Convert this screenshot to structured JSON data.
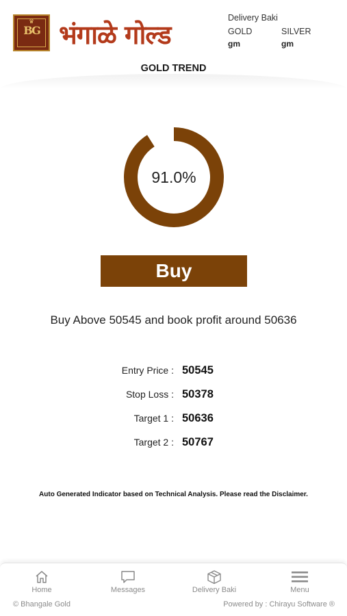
{
  "header": {
    "logo_icon": "bg-monogram-logo",
    "brand_name": "भंगाळे गोल्ड",
    "delivery_baki_title": "Delivery Baki",
    "gold_label": "GOLD",
    "gold_unit": "gm",
    "silver_label": "SILVER",
    "silver_unit": "gm"
  },
  "page": {
    "title": "GOLD TREND"
  },
  "gauge": {
    "percent_text": "91.0%",
    "fraction": 0.91,
    "color": "#7b4208"
  },
  "signal": {
    "label": "Buy",
    "color": "#7b4208"
  },
  "advice": "Buy Above 50545 and book profit around 50636",
  "levels": [
    {
      "label": "Entry Price :",
      "value": "50545"
    },
    {
      "label": "Stop Loss :",
      "value": "50378"
    },
    {
      "label": "Target 1 :",
      "value": "50636"
    },
    {
      "label": "Target 2 :",
      "value": "50767"
    }
  ],
  "disclaimer": "Auto Generated Indicator based on Technical Analysis. Please read the Disclaimer.",
  "nav": [
    {
      "label": "Home",
      "icon": "home-icon"
    },
    {
      "label": "Messages",
      "icon": "message-icon"
    },
    {
      "label": "Delivery Baki",
      "icon": "box-icon"
    },
    {
      "label": "Menu",
      "icon": "menu-icon"
    }
  ],
  "footer": {
    "copyright": "© Bhangale Gold",
    "powered_by": "Powered by : Chirayu Software ®"
  }
}
